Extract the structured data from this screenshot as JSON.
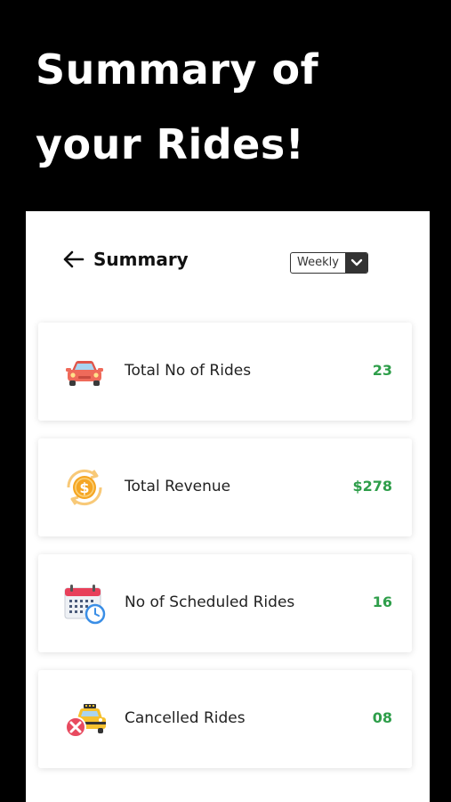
{
  "hero": {
    "title": "Summary of your Rides!"
  },
  "header": {
    "title": "Summary",
    "back_icon": "arrow-left-icon",
    "period_select": {
      "selected": "Weekly",
      "icon": "chevron-down-icon"
    }
  },
  "summary_items": [
    {
      "label": "Total No of Rides",
      "value": "23",
      "icon": "car-icon"
    },
    {
      "label": "Total Revenue",
      "value": "$278",
      "icon": "dollar-coin-icon"
    },
    {
      "label": "No of Scheduled Rides",
      "value": "16",
      "icon": "calendar-clock-icon"
    },
    {
      "label": "Cancelled Rides",
      "value": "08",
      "icon": "cancelled-taxi-icon"
    }
  ],
  "colors": {
    "background": "#000000",
    "panel": "#ffffff",
    "value_green": "#2e9e4a",
    "car_red": "#ef6a5a",
    "coin_orange": "#f5a623",
    "calendar_red": "#e8405a",
    "clock_blue": "#3a8ee6",
    "taxi_yellow": "#f6c12e",
    "cancel_red": "#e84a5f"
  }
}
